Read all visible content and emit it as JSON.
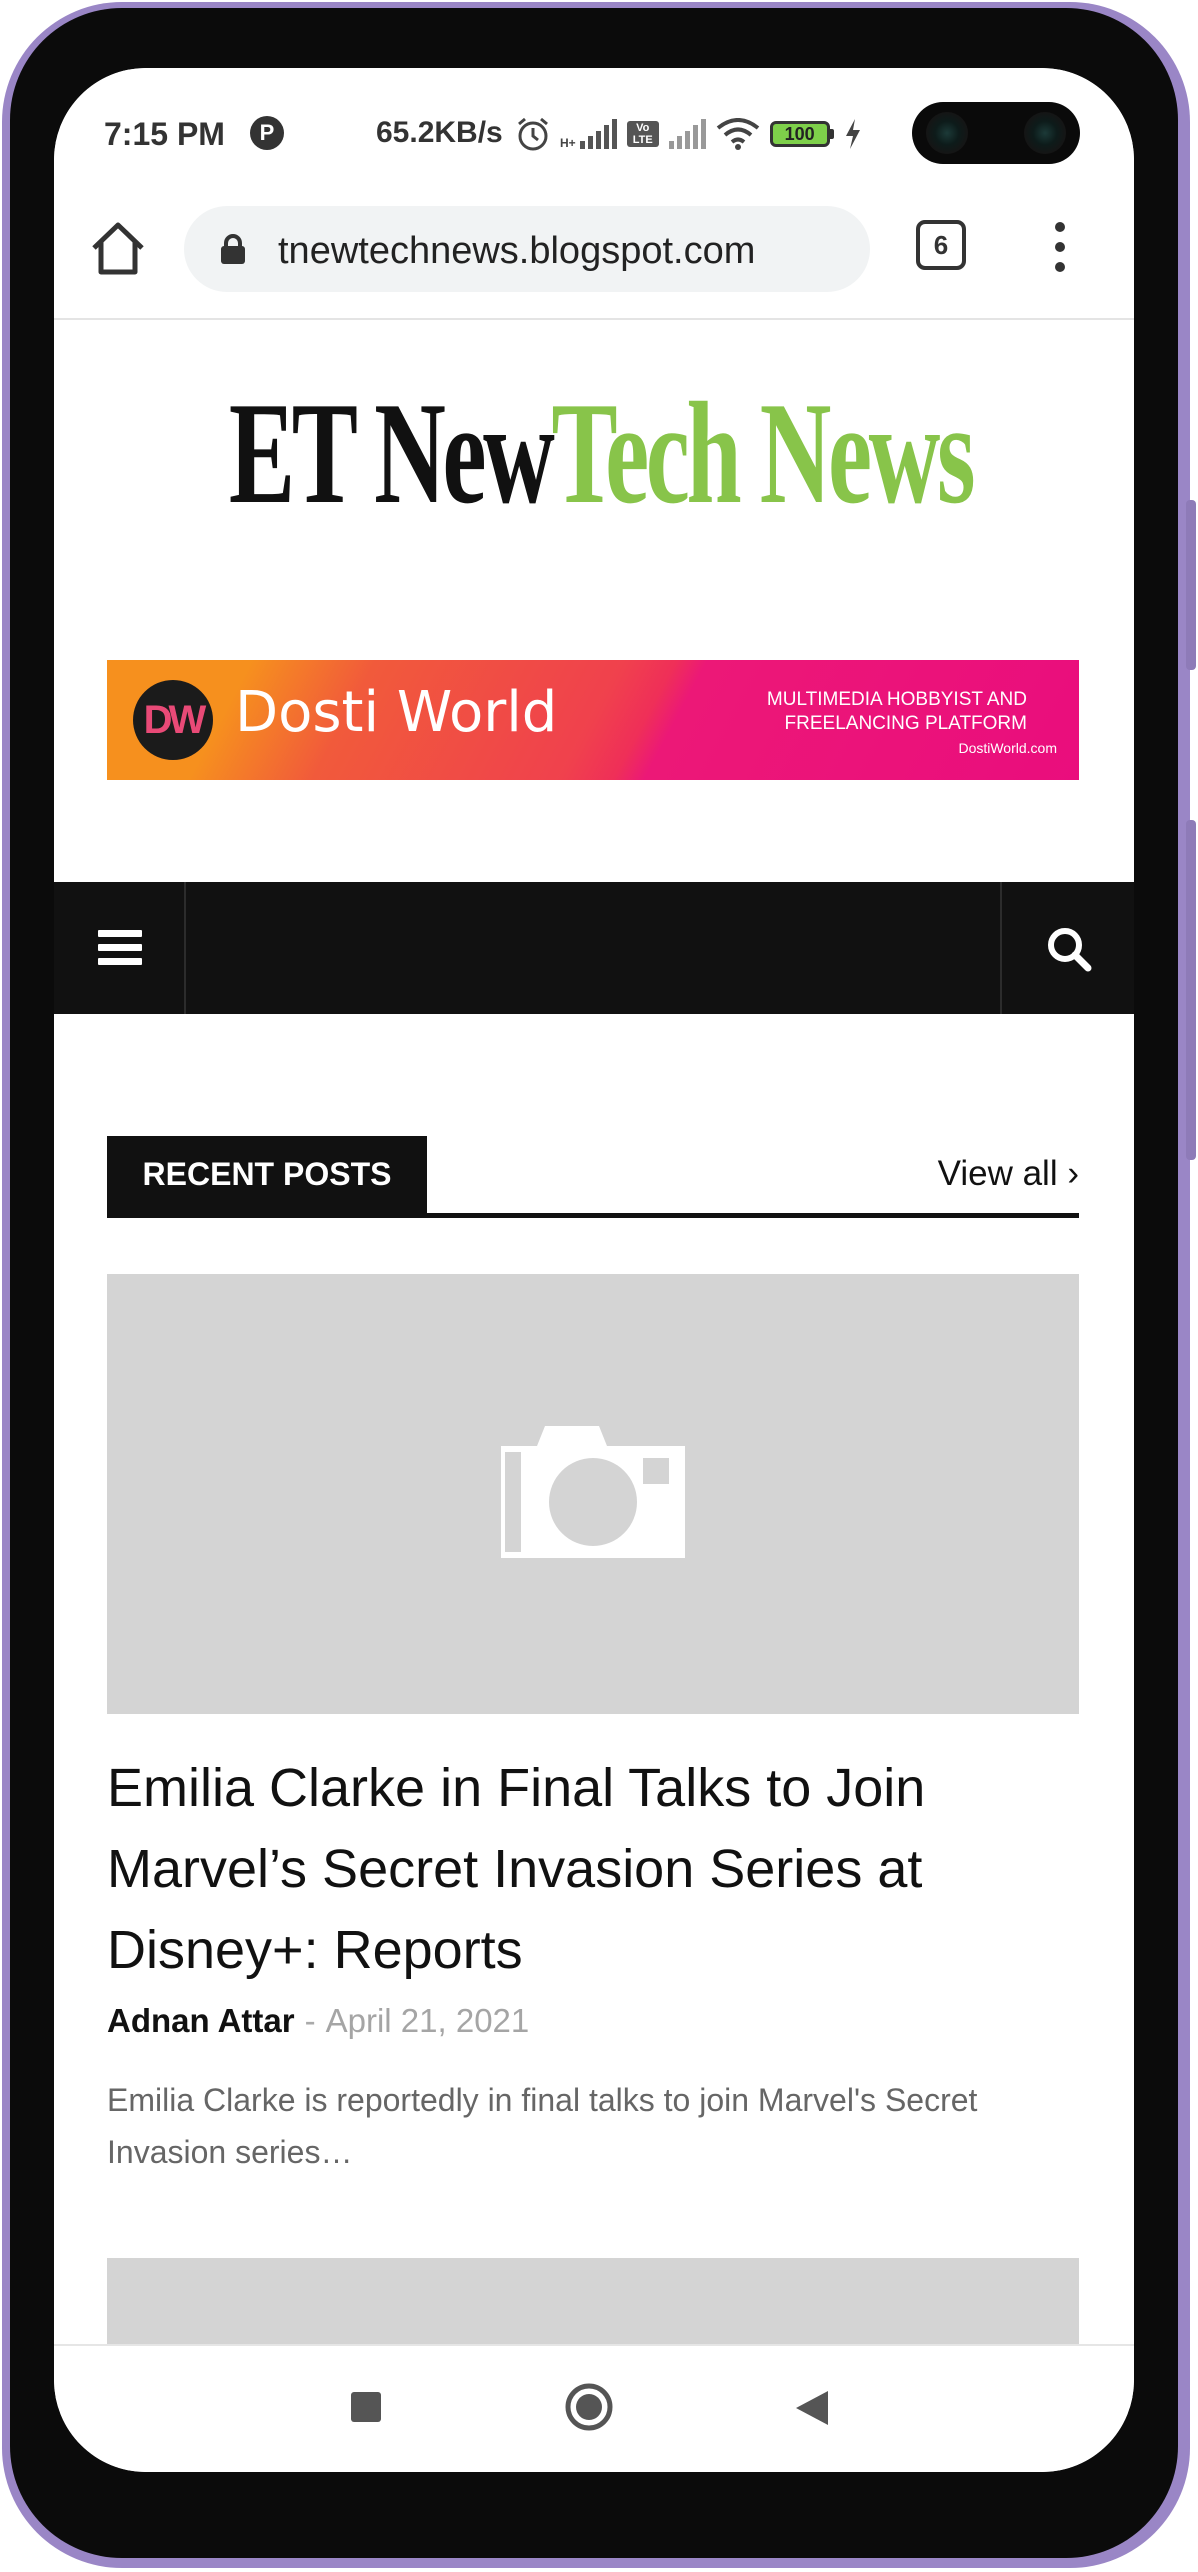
{
  "status_bar": {
    "time": "7:15 PM",
    "notification_icon": "P",
    "network_speed": "65.2KB/s",
    "network_type": "H+",
    "volte": "Vo LTE",
    "battery": "100",
    "icons": [
      "alarm-icon",
      "signal-icon",
      "volte-icon",
      "wifi-icon",
      "battery-icon",
      "charging-icon"
    ]
  },
  "browser": {
    "url": "tnewtechnews.blogspot.com",
    "tab_count": "6",
    "icons": [
      "home-icon",
      "lock-icon",
      "tabs-icon",
      "more-vert-icon"
    ]
  },
  "site": {
    "title_dark": "ET New",
    "title_green": "Tech News",
    "colors": {
      "dark": "#111111",
      "green": "#88c44a"
    }
  },
  "banner": {
    "logo_text": "DW",
    "name": "Dosti World",
    "tagline_line1": "MULTIMEDIA HOBBYIST AND",
    "tagline_line2": "FREELANCING PLATFORM",
    "url": "DostiWorld.com",
    "colors": {
      "orange": "#f6901e",
      "pink": "#ea0d7d"
    }
  },
  "navbar": {
    "icons": [
      "menu-icon",
      "search-icon"
    ],
    "color": "#111111"
  },
  "section": {
    "label": "RECENT POSTS",
    "view_all": "View all ›"
  },
  "post": {
    "title": "Emilia Clarke in Final Talks to Join Marvel’s Secret Invasion Series at Disney+: Reports",
    "author": "Adnan Attar",
    "separator": "-",
    "date": "April 21, 2021",
    "excerpt": "Emilia Clarke is reportedly in final talks to join Marvel's Secret Invasion series…",
    "thumbnail_icon": "camera-icon"
  },
  "system_nav": {
    "icons": [
      "recents-icon",
      "home-circle-icon",
      "back-icon"
    ]
  }
}
